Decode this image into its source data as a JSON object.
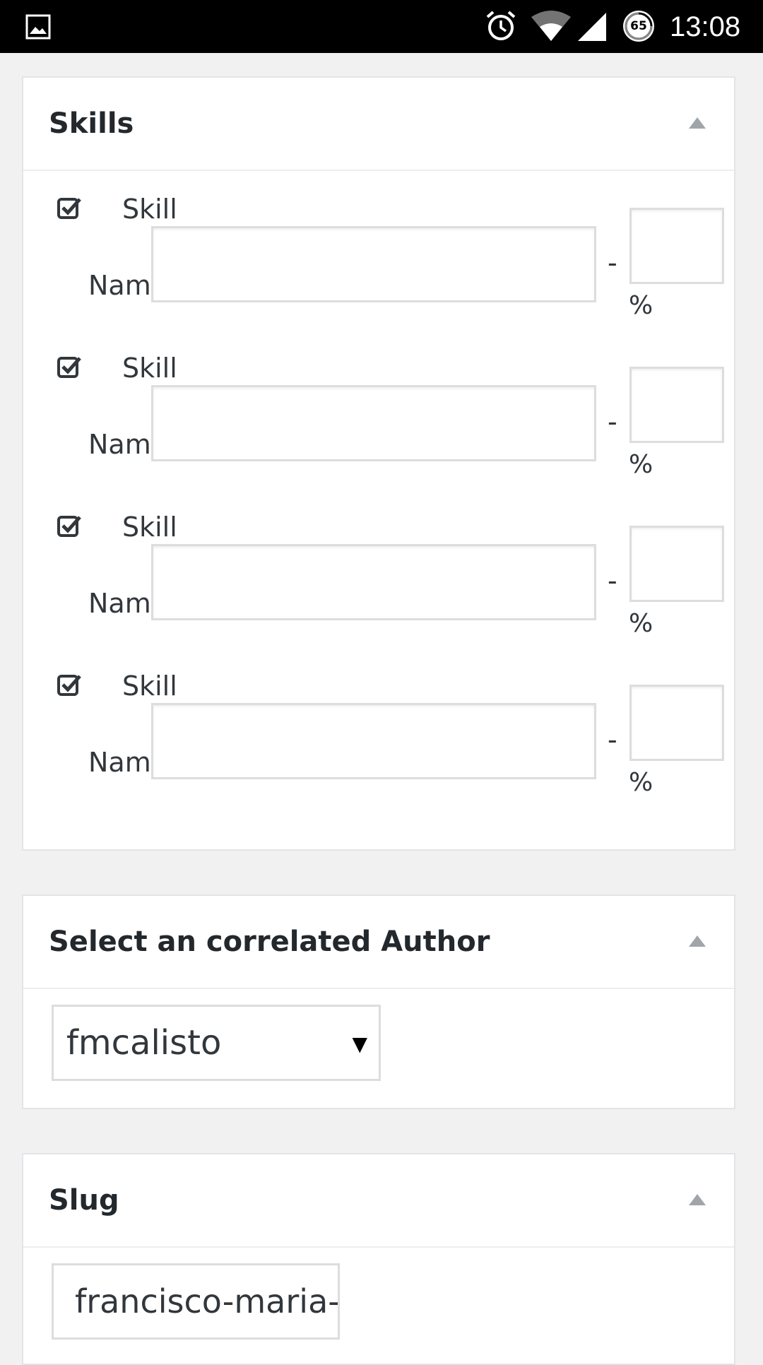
{
  "status_bar": {
    "time": "13:08",
    "battery_level": "65",
    "icons": [
      "gallery-icon",
      "alarm-icon",
      "wifi-icon",
      "signal-icon",
      "battery-icon"
    ]
  },
  "skills_panel": {
    "title": "Skills",
    "rows": [
      {
        "label_top": "Skill",
        "label_bottom": "Name:",
        "dash": "-",
        "percent": "%",
        "checked": true,
        "name_value": "",
        "percent_value": ""
      },
      {
        "label_top": "Skill",
        "label_bottom": "Name:",
        "dash": "-",
        "percent": "%",
        "checked": true,
        "name_value": "",
        "percent_value": ""
      },
      {
        "label_top": "Skill",
        "label_bottom": "Name:",
        "dash": "-",
        "percent": "%",
        "checked": true,
        "name_value": "",
        "percent_value": ""
      },
      {
        "label_top": "Skill",
        "label_bottom": "Name:",
        "dash": "-",
        "percent": "%",
        "checked": true,
        "name_value": "",
        "percent_value": ""
      }
    ]
  },
  "author_panel": {
    "title": "Select an correlated Author",
    "selected": "fmcalisto",
    "arrow": "▼"
  },
  "slug_panel": {
    "title": "Slug",
    "value": "francisco-maria-c"
  },
  "colors": {
    "panel_bg": "#ffffff",
    "page_bg": "#f1f1f1",
    "border": "#dddddd",
    "text": "#23282d",
    "toggle": "#a0a5aa"
  }
}
